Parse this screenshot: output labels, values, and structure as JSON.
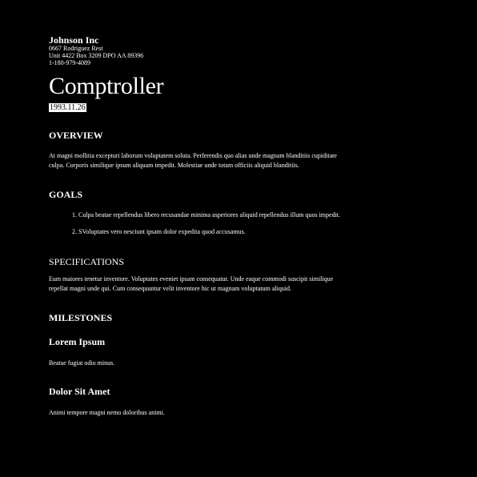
{
  "header": {
    "company": "Johnson Inc",
    "address_line1": "0667 Rodriguez Rest",
    "address_line2": "Unit 4422 Box 3209 DPO AA 89396",
    "phone": "1-180-979-4089"
  },
  "title": "Comptroller",
  "date": "1993.11.26",
  "sections": {
    "overview": {
      "heading": "OVERVIEW",
      "text": "At magni mollitia excepturi laborum voluptatem soluta. Perferendis quo alias unde magnam blanditiis cupiditate culpa. Corporis similique ipsum aliquam impedit. Molestiae unde totam officiis aliquid blanditiis."
    },
    "goals": {
      "heading": "GOALS",
      "items": [
        "1. Culpa beatae repellendus libero recusandae minima asperiores aliquid repellendus illum quos impedit.",
        "2. SVoluptates vero nesciunt ipsam dolor expedita quod accusamus."
      ]
    },
    "specifications": {
      "heading": "SPECIFICATIONS",
      "text": "Eum maiores tenetur inventore. Voluptates eveniet ipsam consequatur. Unde eaque commodi suscipit similique repellat magni unde qui. Cum consequuntur velit inventore hic ut magnam voluptatum aliquid."
    },
    "milestones": {
      "heading": "MILESTONES",
      "items": [
        {
          "title": "Lorem Ipsum",
          "text": "Beatae fugiat odio minus."
        },
        {
          "title": "Dolor Sit Amet",
          "text": "Animi tempore magni nemo doloribus animi."
        }
      ]
    }
  },
  "colors": {
    "background": "#000000",
    "text": "#ffffff",
    "date_highlight": "#ffffff"
  }
}
